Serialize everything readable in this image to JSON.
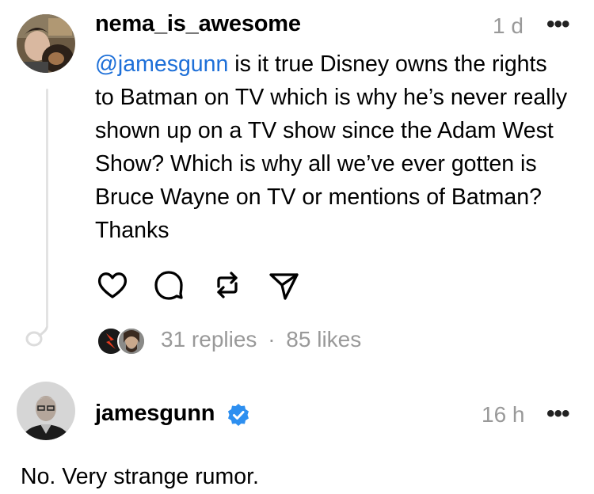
{
  "post": {
    "username": "nema_is_awesome",
    "time": "1 d",
    "mention": "@jamesgunn",
    "body": " is it true Disney owns the rights to Batman on TV which is why he’s never really shown up on a TV show since the Adam West Show? Which is why all we’ve ever gotten is Bruce Wayne on TV or mentions of Batman? Thanks",
    "replies_label": "31 replies",
    "separator": "·",
    "likes_label": "85 likes",
    "actions": [
      "heart-icon",
      "comment-icon",
      "repost-icon",
      "share-icon"
    ]
  },
  "reply": {
    "username": "jamesgunn",
    "verified": true,
    "time": "16 h",
    "body": "No. Very strange rumor."
  },
  "colors": {
    "mention": "#1d6fd8",
    "verified_badge": "#2d8ff0",
    "muted_text": "#999999"
  }
}
